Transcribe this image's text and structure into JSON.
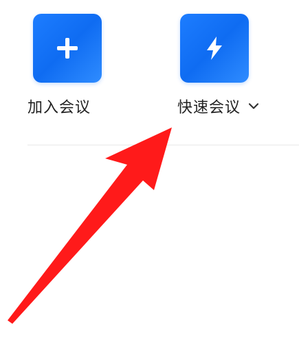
{
  "actions": {
    "join": {
      "label": "加入会议",
      "icon": "plus-icon"
    },
    "quick": {
      "label": "快速会议",
      "icon": "lightning-icon",
      "dropdown_icon": "chevron-down-icon"
    }
  },
  "annotation": {
    "arrow_color": "#ff1a1a"
  },
  "colors": {
    "accent": "#1d7dff",
    "label_text": "#222222",
    "divider": "#e8e8e8"
  }
}
